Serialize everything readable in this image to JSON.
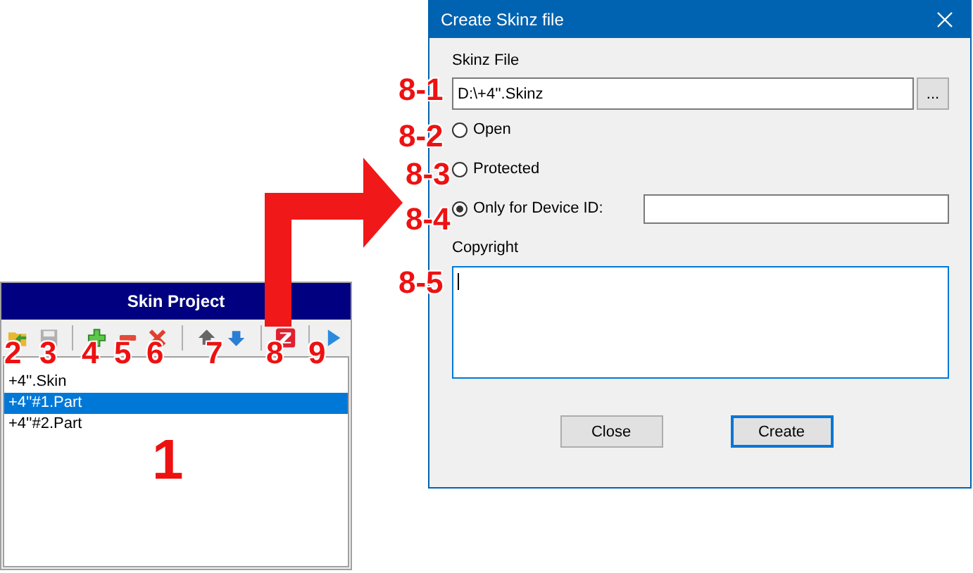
{
  "skin_project": {
    "title": "Skin Project",
    "items": [
      {
        "label": "+4''.Skin",
        "selected": false
      },
      {
        "label": "+4''#1.Part",
        "selected": true
      },
      {
        "label": "+4''#2.Part",
        "selected": false
      }
    ]
  },
  "dialog": {
    "title": "Create Skinz file",
    "file_label": "Skinz File",
    "file_value": "D:\\+4''.Skinz",
    "browse_button": "...",
    "options": [
      {
        "label": "Open",
        "selected": false
      },
      {
        "label": "Protected",
        "selected": false
      },
      {
        "label": "Only for Device ID:",
        "selected": true
      }
    ],
    "copyright_label": "Copyright",
    "buttons": [
      {
        "label": "Close",
        "default": false
      },
      {
        "label": "Create",
        "default": true
      }
    ]
  },
  "annotations": [
    "1",
    "2",
    "3",
    "4",
    "5",
    "6",
    "7",
    "8",
    "9",
    "8-1",
    "8-2",
    "8-3",
    "8-4",
    "8-5"
  ]
}
